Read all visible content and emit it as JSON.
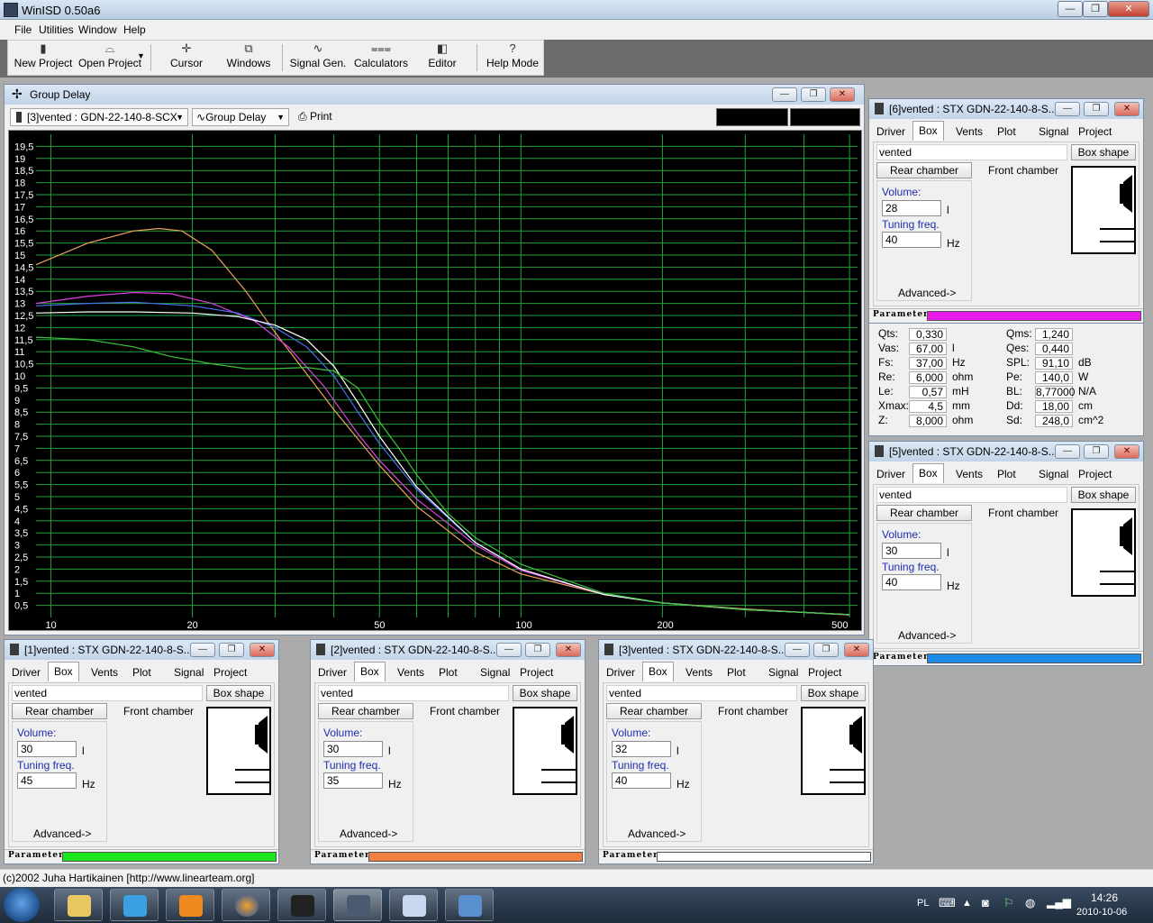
{
  "app": {
    "title": "WinISD 0.50a6"
  },
  "window_buttons": {
    "minimize": "—",
    "maximize": "❐",
    "close": "✕"
  },
  "menu": [
    "File",
    "Utilities",
    "Window",
    "Help"
  ],
  "toolbar": [
    {
      "label": "New Project",
      "icon": "new-project-icon"
    },
    {
      "label": "Open Project",
      "icon": "open-project-icon"
    },
    {
      "label": "Cursor",
      "icon": "cursor-icon"
    },
    {
      "label": "Windows",
      "icon": "windows-icon"
    },
    {
      "label": "Signal Gen.",
      "icon": "signal-generator-icon"
    },
    {
      "label": "Calculators",
      "icon": "calculators-icon"
    },
    {
      "label": "Editor",
      "icon": "editor-icon"
    },
    {
      "label": "Help Mode",
      "icon": "help-mode-icon"
    }
  ],
  "group_delay": {
    "title": "Group Delay",
    "project_select": "[3]vented : GDN-22-140-8-SCX",
    "view_select": "Group Delay",
    "print_label": "Print"
  },
  "chart_data": {
    "type": "line",
    "xlog": true,
    "xlim": [
      9.3,
      520
    ],
    "ylim": [
      0,
      20
    ],
    "x_ticks": [
      10,
      20,
      50,
      100,
      200,
      500
    ],
    "x_tick_labels": [
      "10",
      "20",
      "50",
      "100",
      "200",
      "500"
    ],
    "y_tick_labels": [
      "19,5",
      "19",
      "18,5",
      "18",
      "17,5",
      "17",
      "16,5",
      "16",
      "15,5",
      "15",
      "14,5",
      "14",
      "13,5",
      "13",
      "12,5",
      "12",
      "11,5",
      "11",
      "10,5",
      "10",
      "9,5",
      "9",
      "8,5",
      "8",
      "7,5",
      "7",
      "6,5",
      "6",
      "5,5",
      "5",
      "4,5",
      "4",
      "3,5",
      "3",
      "2,5",
      "2",
      "1,5",
      "1",
      "0,5"
    ],
    "grid": true,
    "series": [
      {
        "color": "#f0a15e",
        "x": [
          9.3,
          12,
          15,
          17,
          19,
          22,
          26,
          30,
          40,
          50,
          60,
          80,
          100,
          150,
          200,
          300,
          500
        ],
        "y": [
          14.6,
          15.5,
          16.0,
          16.1,
          16.0,
          15.2,
          13.5,
          11.8,
          8.6,
          6.3,
          4.6,
          2.7,
          1.8,
          0.95,
          0.6,
          0.35,
          0.1
        ]
      },
      {
        "color": "#e040e0",
        "x": [
          9.3,
          12,
          15,
          18,
          22,
          27,
          32,
          38,
          45,
          50,
          60,
          80,
          100,
          150,
          200,
          300,
          500
        ],
        "y": [
          13.0,
          13.3,
          13.45,
          13.4,
          13.0,
          12.3,
          11.2,
          9.6,
          7.6,
          6.5,
          4.9,
          3.0,
          1.95,
          0.95,
          0.6,
          0.32,
          0.12
        ]
      },
      {
        "color": "#4a70f0",
        "x": [
          9.3,
          12,
          15,
          20,
          25,
          30,
          35,
          40,
          45,
          50,
          60,
          80,
          100,
          150,
          200,
          300,
          500
        ],
        "y": [
          12.9,
          13.0,
          13.05,
          12.9,
          12.6,
          12.0,
          11.2,
          10.0,
          8.5,
          7.2,
          5.3,
          3.1,
          2.0,
          0.95,
          0.6,
          0.32,
          0.12
        ]
      },
      {
        "color": "#ffffff",
        "x": [
          9.3,
          12,
          15,
          20,
          25,
          30,
          35,
          40,
          45,
          50,
          60,
          80,
          100,
          150,
          200,
          300,
          500
        ],
        "y": [
          12.6,
          12.65,
          12.65,
          12.6,
          12.45,
          12.1,
          11.5,
          10.4,
          8.9,
          7.5,
          5.4,
          3.1,
          2.0,
          0.95,
          0.6,
          0.32,
          0.12
        ]
      },
      {
        "color": "#3ec43e",
        "x": [
          9.3,
          12,
          15,
          18,
          22,
          26,
          30,
          35,
          40,
          45,
          50,
          55,
          60,
          70,
          80,
          100,
          150,
          200,
          300,
          500
        ],
        "y": [
          11.6,
          11.5,
          11.2,
          10.8,
          10.5,
          10.3,
          10.3,
          10.35,
          10.2,
          9.5,
          8.1,
          7.0,
          5.9,
          4.3,
          3.3,
          2.2,
          1.0,
          0.6,
          0.32,
          0.12
        ]
      }
    ]
  },
  "box_window": {
    "tabs": [
      "Driver",
      "Box",
      "Vents",
      "Plot",
      "Signal",
      "Project"
    ],
    "box_type": "vented",
    "box_shape_label": "Box shape",
    "rear_chamber_label": "Rear chamber",
    "front_chamber_label": "Front chamber",
    "volume_label": "Volume:",
    "volume_unit": "l",
    "tuning_label": "Tuning freq.",
    "tuning_unit": "Hz",
    "advanced_label": "Advanced->",
    "params_label": "Parameters"
  },
  "projects": [
    {
      "title": "[6]vented : STX GDN-22-140-8-S...",
      "volume": "28",
      "tuning": "40",
      "color": "#e81be8"
    },
    {
      "title": "[5]vented : STX GDN-22-140-8-S...",
      "volume": "30",
      "tuning": "40",
      "color": "#1e8ce6"
    },
    {
      "title": "[1]vented : STX GDN-22-140-8-S...",
      "volume": "30",
      "tuning": "45",
      "color": "#1ee61e"
    },
    {
      "title": "[2]vented : STX GDN-22-140-8-S...",
      "volume": "30",
      "tuning": "35",
      "color": "#f08040"
    },
    {
      "title": "[3]vented : STX GDN-22-140-8-S...",
      "volume": "32",
      "tuning": "40",
      "color": "#ffffff"
    }
  ],
  "driver_params": [
    {
      "label": "Qts:",
      "value": "0,330",
      "unit": ""
    },
    {
      "label": "Vas:",
      "value": "67,00",
      "unit": "l"
    },
    {
      "label": "Fs:",
      "value": "37,00",
      "unit": "Hz"
    },
    {
      "label": "Re:",
      "value": "6,000",
      "unit": "ohm"
    },
    {
      "label": "Le:",
      "value": "0,57",
      "unit": "mH"
    },
    {
      "label": "Xmax:",
      "value": "4,5",
      "unit": "mm"
    },
    {
      "label": "Z:",
      "value": "8,000",
      "unit": "ohm"
    },
    {
      "label": "Qms:",
      "value": "1,240",
      "unit": ""
    },
    {
      "label": "Qes:",
      "value": "0,440",
      "unit": ""
    },
    {
      "label": "SPL:",
      "value": "91,10",
      "unit": "dB"
    },
    {
      "label": "Pe:",
      "value": "140,0",
      "unit": "W"
    },
    {
      "label": "BL:",
      "value": "8,77000",
      "unit": "N/A"
    },
    {
      "label": "Dd:",
      "value": "18,00",
      "unit": "cm"
    },
    {
      "label": "Sd:",
      "value": "248,0",
      "unit": "cm^2"
    }
  ],
  "status_text": "(c)2002 Juha Hartikainen [http://www.linearteam.org]",
  "taskbar": {
    "items": [
      "explorer-icon",
      "itunes-icon",
      "media-player-icon",
      "firefox-icon",
      "app-icon",
      "winisd-icon",
      "paint-icon",
      "picture-icon"
    ],
    "language": "PL",
    "time": "14:26",
    "date": "2010-10-06"
  }
}
